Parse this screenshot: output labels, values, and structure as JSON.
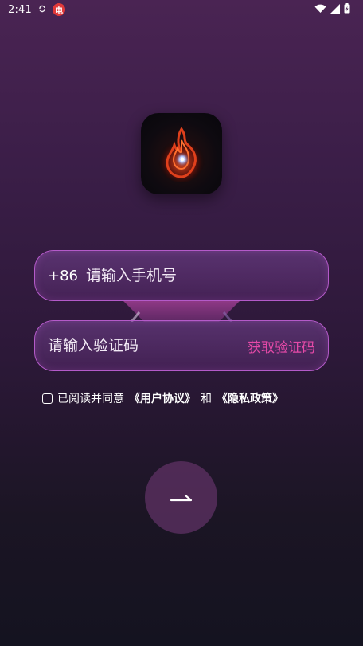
{
  "status_bar": {
    "time": "2:41",
    "sync_icon": "sync-icon",
    "notification_badge": "电",
    "icons": [
      "wifi-icon",
      "signal-icon",
      "battery-icon"
    ]
  },
  "logo": {
    "icon": "flame-logo-icon"
  },
  "phone": {
    "prefix": "+86",
    "placeholder": "请输入手机号"
  },
  "code": {
    "placeholder": "请输入验证码",
    "get_code_label": "获取验证码"
  },
  "agreement": {
    "prefix": "已阅读并同意",
    "user_agreement": "《用户协议》",
    "and": "和",
    "privacy_policy": "《隐私政策》"
  },
  "next_button": {
    "icon": "arrow-right-icon"
  },
  "colors": {
    "accent": "#e64aa8",
    "field_border": "#b45ac9"
  }
}
